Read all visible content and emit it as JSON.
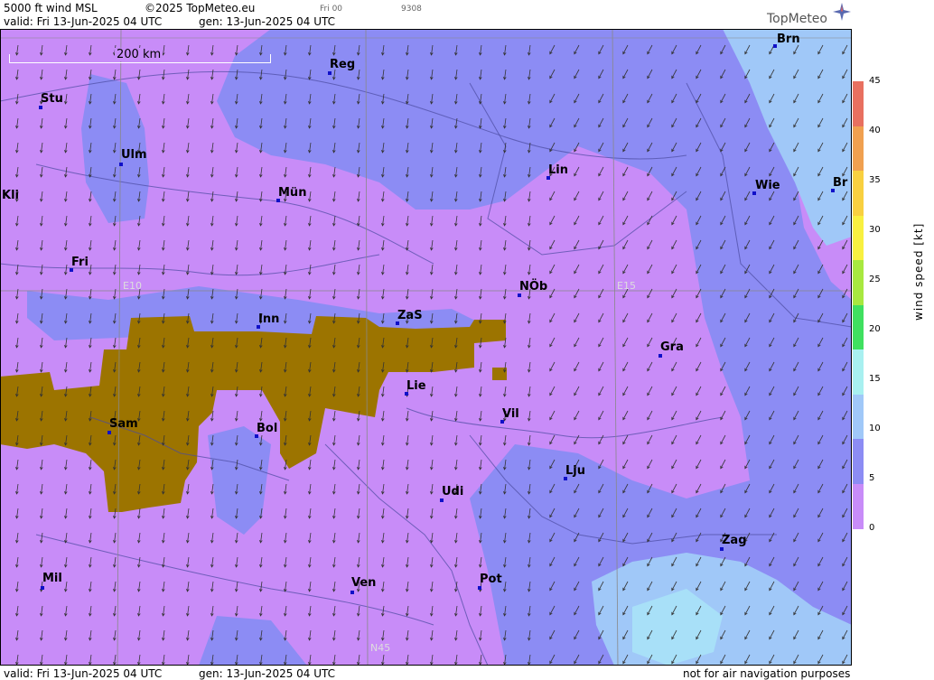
{
  "header": {
    "title": "5000 ft wind MSL",
    "copyright": "©2025 TopMeteo.eu",
    "run": "Fri 00",
    "code": "9308",
    "valid": "valid:  Fri  13-Jun-2025  04 UTC",
    "gen": "gen: 13-Jun-2025 04 UTC",
    "logo": "TopMeteo"
  },
  "footer": {
    "valid": "valid:  Fri  13-Jun-2025  04 UTC",
    "gen": "gen: 13-Jun-2025 04 UTC",
    "disclaimer": "not for air navigation purposes"
  },
  "map": {
    "scale_label": "200 km",
    "grid_labels": {
      "lon10": "E10",
      "lon15": "E15",
      "lat45": "N45"
    },
    "terrain_color": "#9c7400",
    "colors": {
      "lilac": "#c88cf8",
      "violet": "#8c8cf4",
      "blue": "#a0c8f8",
      "cyan": "#a8e0f8"
    },
    "cities": [
      {
        "name": "Stu"
      },
      {
        "name": "Reg"
      },
      {
        "name": "Brn"
      },
      {
        "name": "Ulm"
      },
      {
        "name": "Kli"
      },
      {
        "name": "Mün"
      },
      {
        "name": "Lin"
      },
      {
        "name": "Wie"
      },
      {
        "name": "Br"
      },
      {
        "name": "Fri"
      },
      {
        "name": "NÖb"
      },
      {
        "name": "Inn"
      },
      {
        "name": "ZaS"
      },
      {
        "name": "Gra"
      },
      {
        "name": "Lie"
      },
      {
        "name": "Vil"
      },
      {
        "name": "Sam"
      },
      {
        "name": "Bol"
      },
      {
        "name": "Lju"
      },
      {
        "name": "Udi"
      },
      {
        "name": "Zag"
      },
      {
        "name": "Mil"
      },
      {
        "name": "Ven"
      },
      {
        "name": "Pot"
      }
    ]
  },
  "legend": {
    "title": "wind  speed  [kt]",
    "ticks": [
      "45",
      "40",
      "35",
      "30",
      "25",
      "20",
      "15",
      "10",
      "5",
      "0"
    ],
    "colors": [
      "#e87060",
      "#f0a050",
      "#f8d040",
      "#f8f040",
      "#a8e840",
      "#40e060",
      "#a8f0f0",
      "#a0c8f8",
      "#8c8cf4",
      "#c88cf8"
    ]
  }
}
